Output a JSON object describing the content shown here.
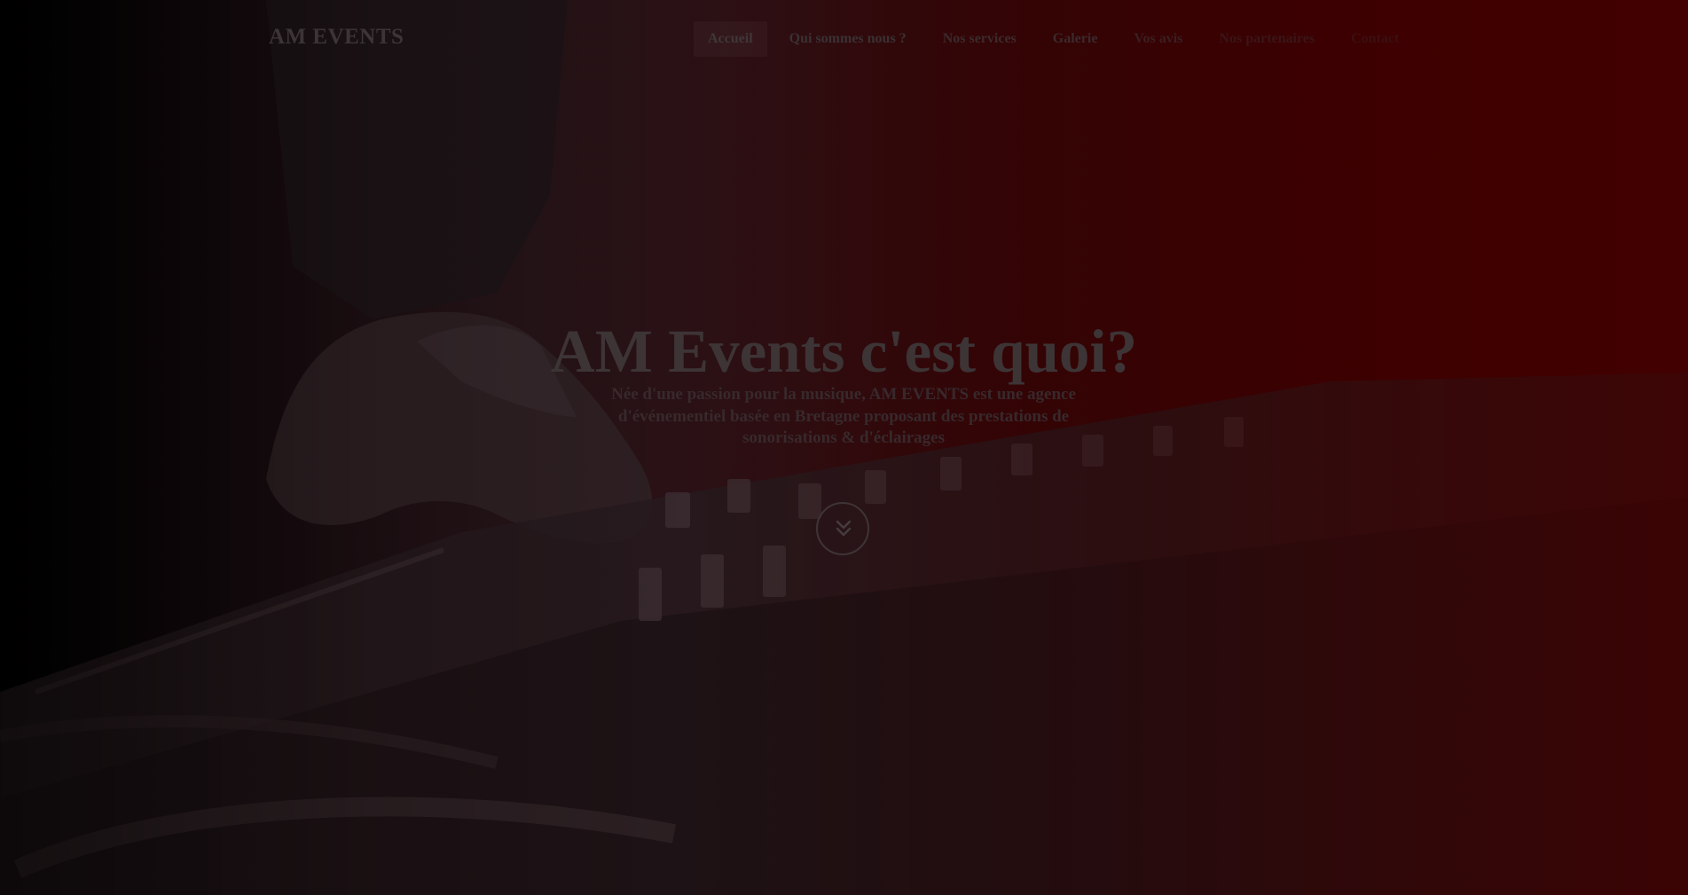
{
  "navbar": {
    "brand": "AM EVENTS",
    "items": [
      {
        "label": "Accueil"
      },
      {
        "label": "Qui sommes nous ?"
      },
      {
        "label": "Nos services"
      },
      {
        "label": "Galerie"
      },
      {
        "label": "Vos avis"
      },
      {
        "label": "Nos partenaires"
      },
      {
        "label": "Contact"
      }
    ]
  },
  "hero": {
    "title": "AM Events c'est quoi?",
    "tagline": "Née d'une passion pour la musique, AM EVENTS est une agence d'événementiel basée en Bretagne proposant des prestations de sonorisations & d'éclairages",
    "scroll_icon": "double-chevron-down-icon"
  },
  "colors": {
    "background_left": "#000000",
    "background_right": "#420000",
    "text": "#3d3436"
  }
}
